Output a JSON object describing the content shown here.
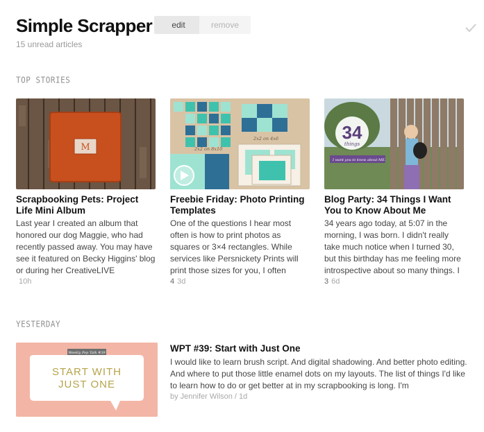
{
  "header": {
    "title": "Simple Scrapper",
    "edit_label": "edit",
    "remove_label": "remove",
    "unread": "15 unread articles"
  },
  "sections": {
    "top": "TOP STORIES",
    "yesterday": "YESTERDAY"
  },
  "cards": [
    {
      "title": "Scrapbooking Pets: Project Life Mini Album",
      "body": "Last year I created an album that honored our dog Maggie, who had recently passed away. You may have see it featured on Becky Higgins' blog or during her CreativeLIVE",
      "count": "",
      "age": "10h"
    },
    {
      "title": "Freebie Friday: Photo Printing Templates",
      "body": "One of the questions I hear most often is how to print photos as squares or 3×4 rectangles. While services like Persnickety Prints will print those sizes for you, I often prefer",
      "count": "4",
      "age": "3d",
      "thumb_labels": [
        "2x2 on 8x10",
        "2x2 on 4x6"
      ]
    },
    {
      "title": "Blog Party: 34 Things I Want You to Know About Me",
      "body": "34 years ago today, at 5:07 in the morning, I was born. I didn't really take much notice when I turned 30, but this birthday has me feeling more introspective about so many things. I",
      "count": "3",
      "age": "6d",
      "thumb_number": "34",
      "thumb_word": "things",
      "thumb_banner": "I want you to know about ME."
    }
  ],
  "wide": {
    "title": "WPT #39: Start with Just One",
    "body": "I would like to learn brush script. And digital shadowing. And better photo editing. And where to put those little enamel dots on my layouts. The list of things I'd like to learn how to do or get better at in my scrapbooking is long. I'm",
    "meta": "by Jennifer Wilson / 1d",
    "thumb_tag": "Weekly Pep Talk #39",
    "thumb_line1": "START WITH",
    "thumb_line2": "JUST ONE"
  },
  "colors": {
    "teal": "#3fc2ad",
    "mint": "#9ee3d2",
    "blue": "#2e6f96",
    "salmon": "#f3b6a6",
    "orange": "#c8501e",
    "olive_text": "#b6a44a"
  }
}
